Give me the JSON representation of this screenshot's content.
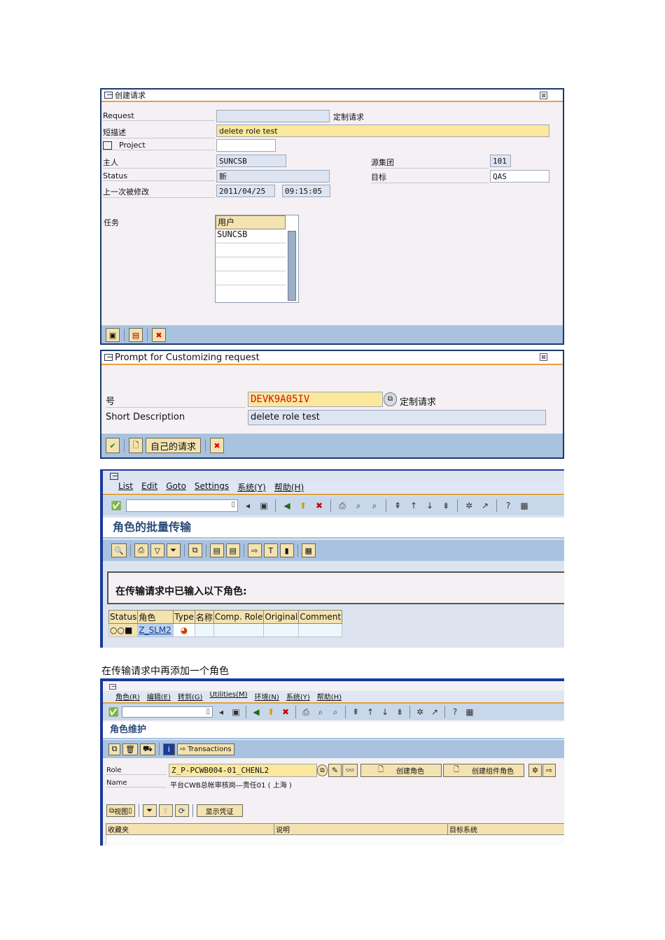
{
  "panel1": {
    "title": "创建请求",
    "close": "⊠",
    "request_label": "Request",
    "request_value": "",
    "request_type": "定制请求",
    "desc_label": "短描述",
    "desc_value": "delete role test",
    "project_label": "Project",
    "project_value": "",
    "owner_label": "主人",
    "owner_value": "SUNCSB",
    "source_client_label": "源集团",
    "source_client_value": "101",
    "status_label": "Status",
    "status_value": "新",
    "target_label": "目标",
    "target_value": "QAS",
    "changed_label": "上一次被修改",
    "changed_date": "2011/04/25",
    "changed_time": "09:15:05",
    "tasks_label": "任务",
    "tasks_header": "用户",
    "tasks": [
      "SUNCSB",
      "",
      "",
      "",
      ""
    ]
  },
  "panel2": {
    "title": "Prompt for Customizing request",
    "close": "⊠",
    "number_label": "号",
    "number_value": "DEVK9A05IV",
    "number_type": "定制请求",
    "shortdesc_label": "Short Description",
    "shortdesc_value": "delete role test",
    "own_requests_button": "自己的请求"
  },
  "panel3": {
    "menu": [
      "List",
      "Edit",
      "Goto",
      "Settings",
      "系统(Y)",
      "帮助(H)"
    ],
    "command_value": "",
    "screen_title": "角色的批量传输",
    "message": "在传输请求中已输入以下角色:",
    "columns": [
      "Status",
      "角色",
      "Type",
      "名称",
      "Comp. Role",
      "Original",
      "Comment"
    ],
    "rows": [
      {
        "status": "○○■",
        "role": "Z_SLM2",
        "type": "◕",
        "name": "",
        "comp_role": "",
        "original": "",
        "comment": ""
      }
    ]
  },
  "caption": "在传输请求中再添加一个角色",
  "panel4": {
    "menu": [
      "角色(R)",
      "编辑(E)",
      "转到(G)",
      "Utilities(M)",
      "环境(N)",
      "系统(Y)",
      "帮助(H)"
    ],
    "command_value": "",
    "screen_title": "角色维护",
    "transactions_button": "Transactions",
    "role_label": "Role",
    "role_value": "Z_P-PCWB004-01_CHENL2",
    "create_role_button": "创建角色",
    "create_composite_button": "创建组件角色",
    "name_label": "Name",
    "name_value": "平台CWB总帐审核岗—责任01 ( 上海 )",
    "view_button": "视图",
    "show_auth_button": "显示凭证",
    "columns": [
      "收藏夹",
      "说明",
      "目标系统"
    ]
  }
}
